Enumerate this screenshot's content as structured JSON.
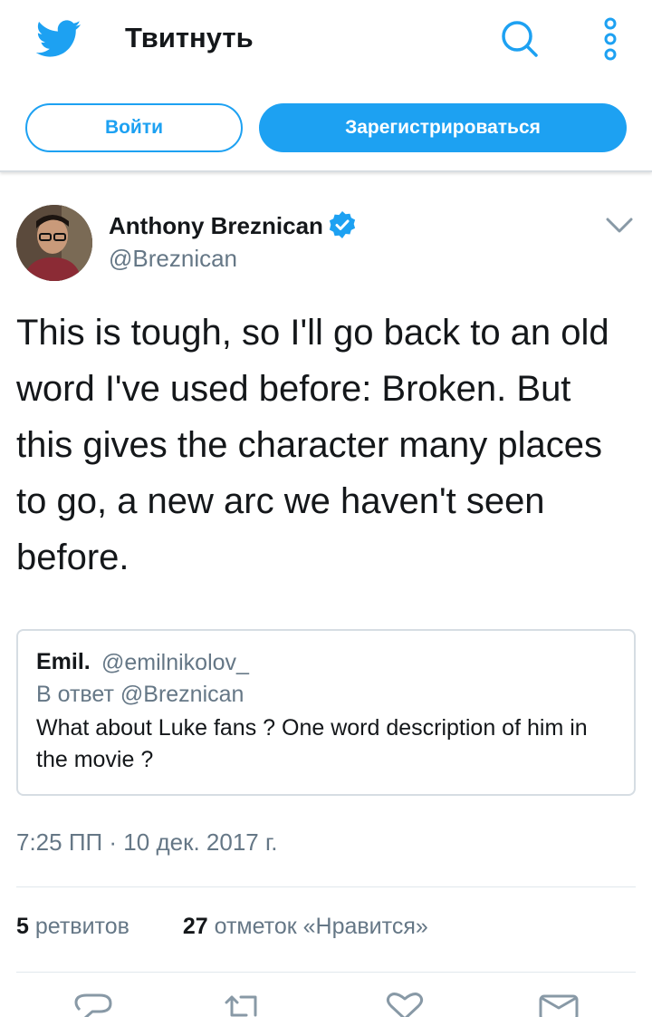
{
  "header": {
    "logo_icon": "twitter-bird-icon",
    "title": "Твитнуть",
    "search_icon": "search-icon",
    "more_icon": "more-vertical-icon",
    "login_label": "Войти",
    "signup_label": "Зарегистрироваться"
  },
  "tweet": {
    "author_name": "Anthony Breznican",
    "author_handle": "@Breznican",
    "verified": true,
    "text": "This is tough, so I'll go back to an old word I've used before: Broken. But this gives the character many places to go, a new arc we haven't seen before.",
    "timestamp": "7:25 ПП · 10 дек. 2017 г."
  },
  "quote": {
    "name": "Emil.",
    "handle": "@emilnikolov_",
    "reply_to": "В ответ @Breznican",
    "text": "What about Luke fans ? One word description of him in the movie ?"
  },
  "stats": {
    "retweets_count": "5",
    "retweets_label": "ретвитов",
    "likes_count": "27",
    "likes_label": "отметок «Нравится»"
  },
  "actions": [
    "reply-icon",
    "retweet-icon",
    "like-icon",
    "message-icon"
  ],
  "colors": {
    "accent": "#1da1f2",
    "text": "#14171a",
    "secondary": "#657786",
    "border": "#e1e8ed"
  }
}
